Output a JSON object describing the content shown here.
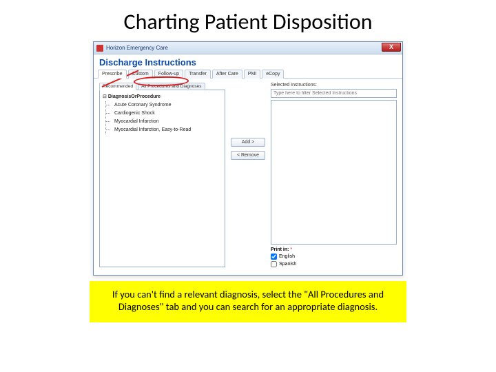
{
  "slide": {
    "title": "Charting Patient Disposition",
    "caption": "If you can't find a relevant diagnosis, select the \"All Procedures and Diagnoses\" tab and you can search for an appropriate diagnosis."
  },
  "window": {
    "title": "Horizon Emergency Care",
    "close": "X",
    "heading": "Discharge Instructions",
    "main_tabs": [
      "Prescribe",
      "Custom",
      "Follow-up",
      "Transfer",
      "After Care",
      "PMI",
      "eCopy"
    ],
    "sub_tabs": {
      "recommended": "Recommended",
      "all": "All Procedures and Diagnoses"
    },
    "tree": {
      "root": "DiagnosisOrProcedure",
      "items": [
        "Acute Coronary Syndrome",
        "Cardiogenic Shock",
        "Myocardial Infarction",
        "Myocardial Infarction, Easy-to-Read"
      ]
    },
    "buttons": {
      "add": "Add >",
      "remove": "< Remove"
    },
    "right": {
      "label": "Selected Instructions:",
      "filter_placeholder": "Type here to filter Selected Instructions"
    },
    "print": {
      "label": "Print in:",
      "req": "*",
      "english": "English",
      "spanish": "Spanish"
    }
  }
}
